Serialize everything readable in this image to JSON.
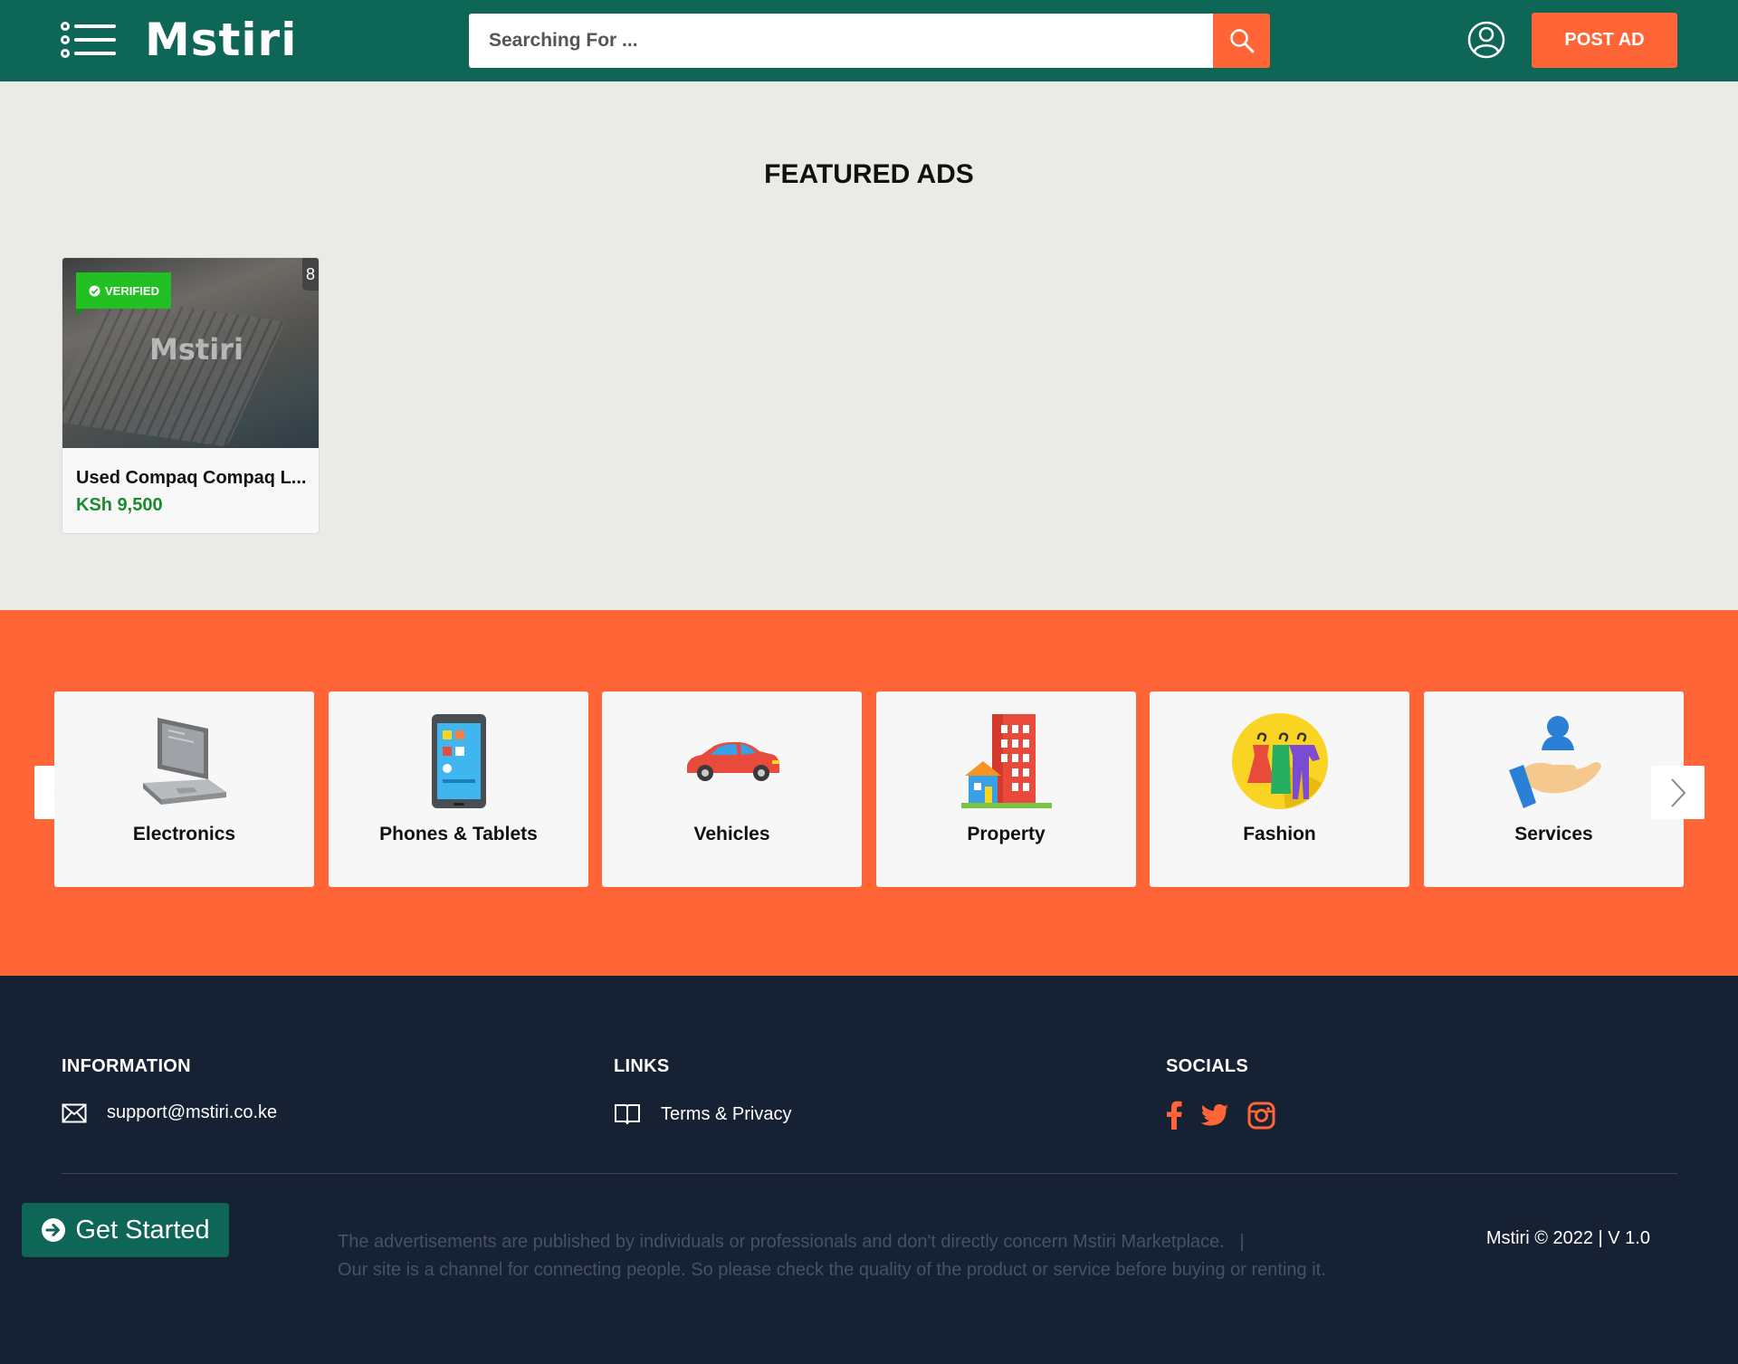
{
  "header": {
    "logo_text": "Mstiri",
    "search_placeholder": "Searching For ...",
    "post_ad_label": "POST AD"
  },
  "featured": {
    "title": "FEATURED ADS",
    "ads": [
      {
        "badge": "VERIFIED",
        "photo_count": "8",
        "watermark": "Mstiri",
        "title": "Used Compaq Compaq L...",
        "price": "KSh 9,500"
      }
    ]
  },
  "categories": [
    {
      "label": "Electronics",
      "icon": "laptop-icon"
    },
    {
      "label": "Phones & Tablets",
      "icon": "phone-icon"
    },
    {
      "label": "Vehicles",
      "icon": "car-icon"
    },
    {
      "label": "Property",
      "icon": "building-icon"
    },
    {
      "label": "Fashion",
      "icon": "clothes-icon"
    },
    {
      "label": "Services",
      "icon": "service-hand-icon"
    }
  ],
  "footer": {
    "information": {
      "heading": "INFORMATION",
      "email": "support@mstiri.co.ke"
    },
    "links": {
      "heading": "LINKS",
      "terms": "Terms & Privacy"
    },
    "socials": {
      "heading": "SOCIALS",
      "items": [
        "facebook-icon",
        "twitter-icon",
        "instagram-icon"
      ]
    },
    "get_started": "Get Started",
    "disclaimer_line1": "The advertisements are published by individuals or professionals and don't directly concern Mstiri Marketplace.   |",
    "disclaimer_line2": "Our site is a channel for connecting people. So please check the quality of the product or service before buying or renting it.",
    "copyright": "Mstiri © 2022 | V 1.0"
  },
  "colors": {
    "header_bg": "#0e6657",
    "accent": "#ff6536",
    "footer_bg": "#172134",
    "price": "#1c8a2e",
    "verified": "#22c022"
  }
}
